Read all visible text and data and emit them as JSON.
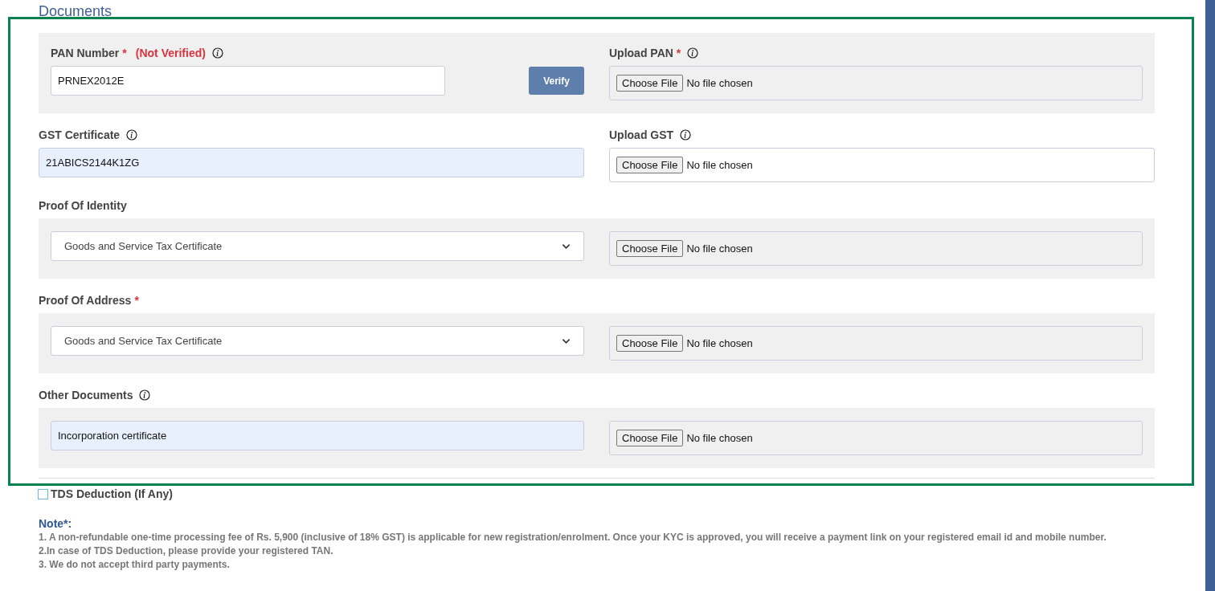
{
  "section_title": "Documents",
  "rows": [
    {
      "label": "PAN Number",
      "required_mark": "*",
      "status": "(Not Verified)",
      "info": true,
      "kind": "shaded",
      "field": {
        "kind": "text",
        "value": "PRNEX2012E"
      },
      "action": "Verify",
      "upload": {
        "label": "Upload PAN",
        "required_mark": "*",
        "info": true,
        "button": "Choose File",
        "status": "No file chosen"
      }
    },
    {
      "label": "GST Certificate",
      "info": true,
      "kind": "plain",
      "field": {
        "kind": "autofilled",
        "value": "21ABICS2144K1ZG"
      },
      "upload": {
        "label": "Upload GST",
        "info": true,
        "button": "Choose File",
        "status": "No file chosen"
      }
    },
    {
      "label": "Proof Of Identity",
      "kind": "shaded",
      "field": {
        "kind": "select",
        "value": "Goods and Service Tax Certificate"
      },
      "upload": {
        "button": "Choose File",
        "status": "No file chosen"
      }
    },
    {
      "label": "Proof Of Address",
      "required_mark": "*",
      "kind": "shaded",
      "field": {
        "kind": "select",
        "value": "Goods and Service Tax Certificate"
      },
      "upload": {
        "button": "Choose File",
        "status": "No file chosen"
      }
    },
    {
      "label": "Other Documents",
      "info": true,
      "kind": "shaded",
      "field": {
        "kind": "autofilled",
        "value": "Incorporation certificate"
      },
      "upload": {
        "button": "Choose File",
        "status": "No file chosen"
      }
    }
  ],
  "tds": {
    "label": "TDS Deduction (If Any)",
    "checked": false
  },
  "note": {
    "title": "Note*:",
    "lines": [
      "1. A non-refundable one-time processing fee of Rs. 5,900 (inclusive of 18% GST) is applicable for new registration/enrolment. Once your KYC is approved, you will receive a payment link on your registered email id and mobile number.",
      "2.In case of TDS Deduction, please provide your registered TAN.",
      "3. We do not accept third party payments."
    ]
  }
}
